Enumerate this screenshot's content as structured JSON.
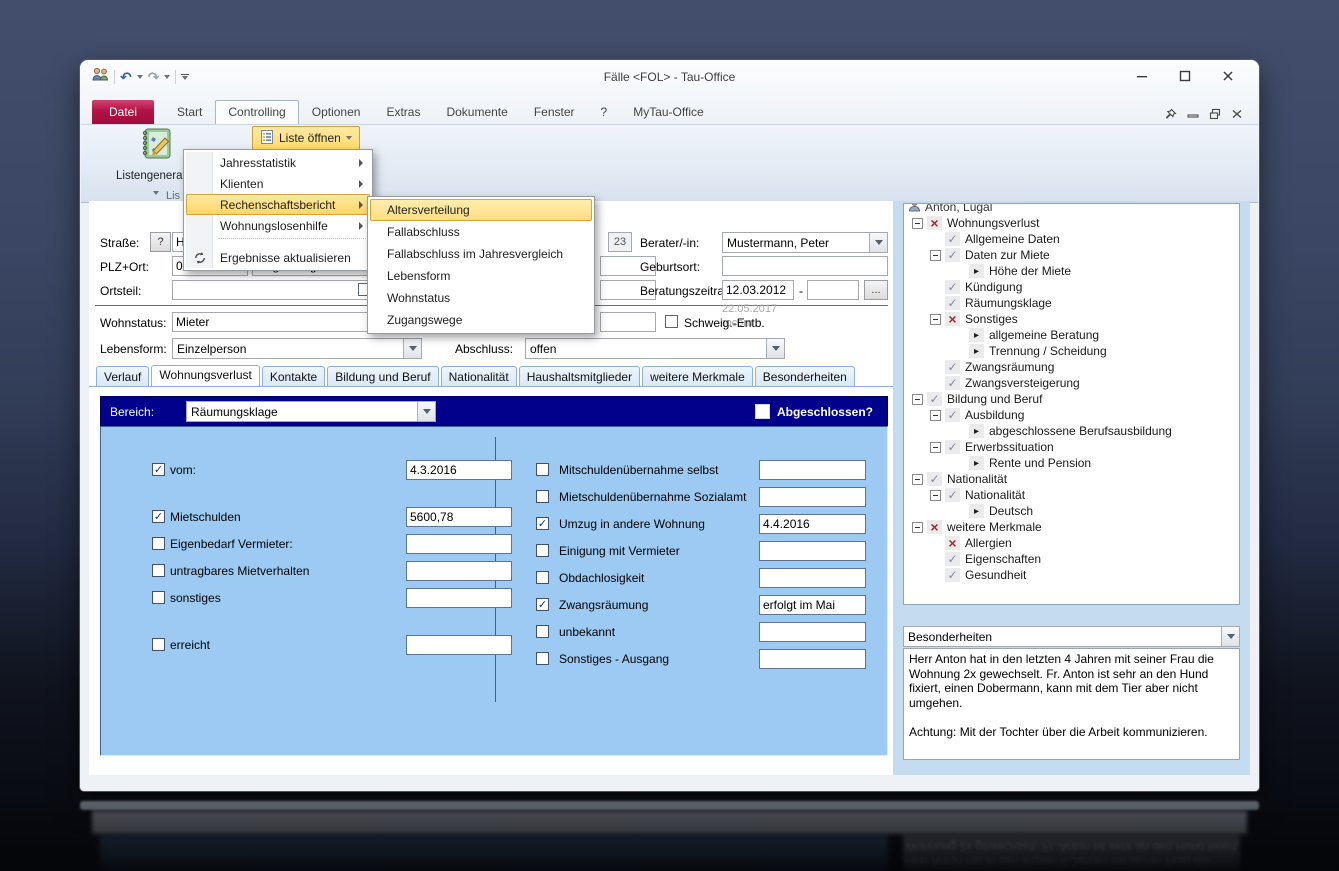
{
  "colors": {
    "accent_red": "#b31246",
    "menu_highlight": "#ffd75f",
    "navy": "#01018b",
    "panel_blue": "#9ccaf2",
    "window_background": "#3a4663"
  },
  "titlebar": {
    "title": "Fälle <FOL> - Tau-Office"
  },
  "ribbon": {
    "tabs": [
      {
        "label": "Datei",
        "is_file": true
      },
      {
        "label": "Start"
      },
      {
        "label": "Controlling",
        "active": true
      },
      {
        "label": "Optionen"
      },
      {
        "label": "Extras"
      },
      {
        "label": "Dokumente"
      },
      {
        "label": "Fenster"
      },
      {
        "label": "?"
      },
      {
        "label": "MyTau-Office"
      }
    ],
    "listengenerator_label": "Listengenerator",
    "liste_oeffnen_label": "Liste öffnen",
    "group_label": "Lis"
  },
  "menu": {
    "items": [
      {
        "label": "Jahresstatistik",
        "submenu": true
      },
      {
        "label": "Klienten",
        "submenu": true
      },
      {
        "label": "Rechenschaftsbericht",
        "submenu": true,
        "highlighted": true
      },
      {
        "label": "Wohnungslosenhilfe",
        "submenu": true
      }
    ],
    "refresh_label": "Ergebnisse aktualisieren",
    "submenu_items": [
      {
        "label": "Altersverteilung",
        "highlighted": true
      },
      {
        "label": "Fallabschluss"
      },
      {
        "label": "Fallabschluss im Jahresvergleich"
      },
      {
        "label": "Lebensform"
      },
      {
        "label": "Wohnstatus"
      },
      {
        "label": "Zugangswege"
      }
    ]
  },
  "form": {
    "strasse_label": "Straße:",
    "strasse_value": "H",
    "help_button": "?",
    "plz_ort_label": "PLZ+Ort:",
    "plz_value": "0",
    "ort_value": "Magdeburg",
    "ortsteil_label": "Ortsteil:",
    "ortsteil_value": "",
    "wohnstatus_label": "Wohnstatus:",
    "wohnstatus_value": "Mieter",
    "lebensform_label": "Lebensform:",
    "lebensform_value": "Einzelperson",
    "alter_value": "23",
    "berater_label": "Berater/-in:",
    "berater_value": "Mustermann, Peter",
    "geburtsort_label": "Geburtsort:",
    "geburtsort_value": "",
    "beratungszeitraum_label": "Beratungszeitraum:",
    "beratung_von": "12.03.2012",
    "beratung_bis": "",
    "date_separator": "-",
    "ellipsis_button": "...",
    "schweig_label": "Schweig.-Entb.",
    "stamp_date": "22.05.2017",
    "stamp_user": "rocom",
    "abschluss_label": "Abschluss:",
    "abschluss_value": "offen"
  },
  "doc_tabs": {
    "items": [
      {
        "label": "Verlauf"
      },
      {
        "label": "Wohnungsverlust",
        "active": true
      },
      {
        "label": "Kontakte"
      },
      {
        "label": "Bildung und Beruf"
      },
      {
        "label": "Nationalität"
      },
      {
        "label": "Haushaltsmitglieder"
      },
      {
        "label": "weitere Merkmale"
      },
      {
        "label": "Besonderheiten"
      }
    ]
  },
  "bereich": {
    "label": "Bereich:",
    "value": "Räumungsklage",
    "abgeschlossen_label": "Abgeschlossen?"
  },
  "panel": {
    "left": [
      {
        "label": "vom:",
        "checked": true,
        "value": "4.3.2016"
      },
      {
        "label": "Mietschulden",
        "checked": true,
        "value": "5600,78",
        "gap_before": true
      },
      {
        "label": "Eigenbedarf Vermieter:",
        "checked": false,
        "value": ""
      },
      {
        "label": "untragbares Mietverhalten",
        "checked": false,
        "value": ""
      },
      {
        "label": "sonstiges",
        "checked": false,
        "value": ""
      },
      {
        "label": "erreicht",
        "checked": false,
        "value": "",
        "gap_before": true
      }
    ],
    "right": [
      {
        "label": "Mitschuldenübernahme selbst",
        "checked": false,
        "value": ""
      },
      {
        "label": "Mietschuldenübernahme Sozialamt",
        "checked": false,
        "value": ""
      },
      {
        "label": "Umzug in andere Wohnung",
        "checked": true,
        "value": "4.4.2016"
      },
      {
        "label": "Einigung mit Vermieter",
        "checked": false,
        "value": ""
      },
      {
        "label": "Obdachlosigkeit",
        "checked": false,
        "value": ""
      },
      {
        "label": "Zwangsräumung",
        "checked": true,
        "value": "erfolgt im Mai"
      },
      {
        "label": "unbekannt",
        "checked": false,
        "value": ""
      },
      {
        "label": "Sonstiges - Ausgang",
        "checked": false,
        "value": ""
      }
    ]
  },
  "tree": {
    "root": "Anton, Lugal",
    "items": [
      {
        "label": "Wohnungsverlust",
        "state": "x",
        "expand": true,
        "level": 1
      },
      {
        "label": "Allgemeine Daten",
        "state": "check",
        "level": 2
      },
      {
        "label": "Daten zur Miete",
        "state": "check",
        "expand": true,
        "level": 2
      },
      {
        "label": "Höhe der Miete",
        "state": "leaf",
        "level": 3
      },
      {
        "label": "Kündigung",
        "state": "check",
        "level": 2
      },
      {
        "label": "Räumungsklage",
        "state": "check",
        "level": 2
      },
      {
        "label": "Sonstiges",
        "state": "x",
        "expand": true,
        "level": 2
      },
      {
        "label": "allgemeine Beratung",
        "state": "leaf",
        "level": 3
      },
      {
        "label": "Trennung / Scheidung",
        "state": "leaf",
        "level": 3
      },
      {
        "label": "Zwangsräumung",
        "state": "check",
        "level": 2
      },
      {
        "label": "Zwangsversteigerung",
        "state": "check",
        "level": 2
      },
      {
        "label": "Bildung und Beruf",
        "state": "check",
        "expand": true,
        "level": 1
      },
      {
        "label": "Ausbildung",
        "state": "check",
        "expand": true,
        "level": 2
      },
      {
        "label": "abgeschlossene Berufsausbildung",
        "state": "leaf",
        "level": 3
      },
      {
        "label": "Erwerbssituation",
        "state": "check",
        "expand": true,
        "level": 2
      },
      {
        "label": "Rente und Pension",
        "state": "leaf",
        "level": 3
      },
      {
        "label": "Nationalität",
        "state": "check",
        "expand": true,
        "level": 1
      },
      {
        "label": "Nationalität",
        "state": "check",
        "expand": true,
        "level": 2
      },
      {
        "label": "Deutsch",
        "state": "leaf",
        "level": 3
      },
      {
        "label": "weitere Merkmale",
        "state": "x",
        "expand": true,
        "level": 1
      },
      {
        "label": "Allergien",
        "state": "x",
        "level": 2
      },
      {
        "label": "Eigenschaften",
        "state": "check",
        "level": 2
      },
      {
        "label": "Gesundheit",
        "state": "check",
        "level": 2
      }
    ]
  },
  "besonderheiten": {
    "header": "Besonderheiten",
    "text": "Herr Anton hat in den letzten 4 Jahren mit seiner Frau die Wohnung 2x gewechselt. Fr. Anton ist sehr an den Hund fixiert, einen Dobermann, kann mit dem Tier aber nicht umgehen.\n\nAchtung: Mit der Tochter über die Arbeit kommunizieren."
  }
}
